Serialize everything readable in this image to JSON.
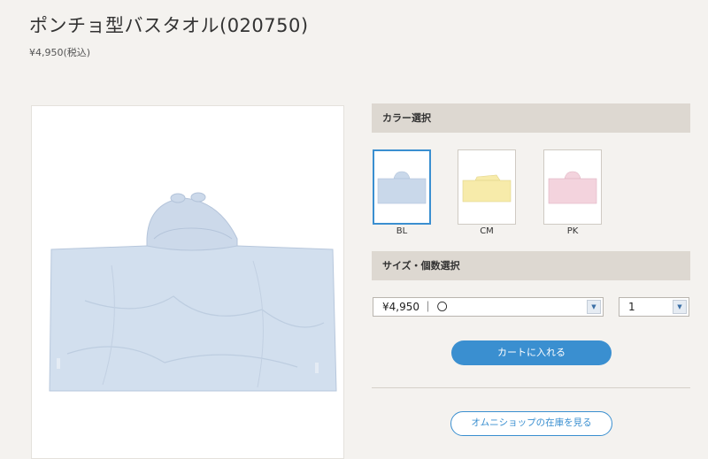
{
  "product": {
    "title": "ポンチョ型バスタオル(020750)",
    "price": "¥4,950(税込)"
  },
  "colors": {
    "section_label": "カラー選択",
    "swatches": [
      {
        "code": "BL",
        "color": "#c9d8ea",
        "selected": true
      },
      {
        "code": "CM",
        "color": "#f7ebaa",
        "selected": false
      },
      {
        "code": "PK",
        "color": "#f3d3dd",
        "selected": false
      }
    ],
    "selected_border": "#3a8fd0"
  },
  "size_quantity": {
    "section_label": "サイズ・個数選択",
    "size_select_value": "¥4,950 ｜ 〇",
    "quantity_select_value": "1"
  },
  "actions": {
    "add_to_cart_label": "カートに入れる",
    "omni_stock_label": "オムニショップの在庫を見る",
    "accent_color": "#3a8fd0"
  }
}
